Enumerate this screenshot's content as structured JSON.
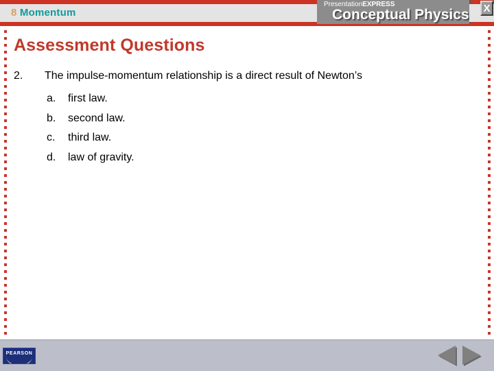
{
  "header": {
    "chapter_number": "8",
    "chapter_title": "Momentum",
    "brand_express_thin": "Presentation",
    "brand_express_bold": "EXPRESS",
    "brand_product": "Conceptual Physics",
    "close_label": "X",
    "accent_red": "#cc3322",
    "chapter_number_color": "#d9a066",
    "chapter_title_color": "#0f9b9b"
  },
  "slide": {
    "title": "Assessment Questions",
    "title_color": "#c0392b",
    "question": {
      "number": "2.",
      "text": "The impulse-momentum relationship is a direct result of Newton’s",
      "choices": [
        {
          "letter": "a.",
          "text": "first law."
        },
        {
          "letter": "b.",
          "text": "second law."
        },
        {
          "letter": "c.",
          "text": "third law."
        },
        {
          "letter": "d.",
          "text": "law of gravity."
        }
      ]
    }
  },
  "footer": {
    "publisher": "PEARSON",
    "prev_icon": "triangle-left-icon",
    "next_icon": "triangle-right-icon",
    "background": "#bcbfc9"
  }
}
